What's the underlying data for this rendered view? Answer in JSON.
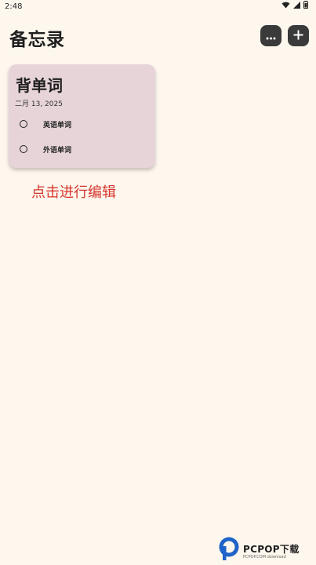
{
  "status_bar": {
    "time": "2:48",
    "icons": [
      "wifi-icon",
      "signal-icon",
      "battery-icon"
    ]
  },
  "app": {
    "title": "备忘录",
    "more_icon": "more-horizontal-icon",
    "add_icon": "plus-icon"
  },
  "note": {
    "title": "背单词",
    "date": "二月 13, 2025",
    "tasks": [
      {
        "label": "英语单词",
        "checked": false
      },
      {
        "label": "外语单词",
        "checked": false
      }
    ],
    "background_color": "#E6D4D8"
  },
  "hint": {
    "text": "点击进行编辑",
    "color": "#D6352B"
  },
  "watermark": {
    "text": "PCPOP下载",
    "subtext": "PCPOP.COM download"
  },
  "colors": {
    "background": "#FEF7EE",
    "button": "#3A3A3A",
    "brand_blue": "#1E63C8"
  }
}
